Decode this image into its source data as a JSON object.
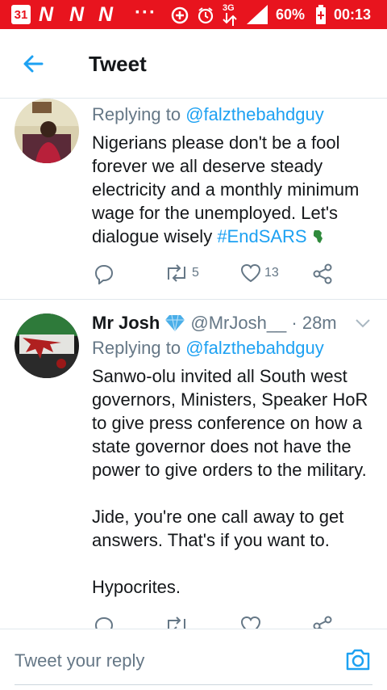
{
  "status_bar": {
    "calendar_day": "31",
    "notif_letters": [
      "N",
      "N",
      "N"
    ],
    "more_dots": "···",
    "network_type": "3G",
    "battery": "60%",
    "time": "00:13",
    "bar_color": "#e8141e"
  },
  "appbar": {
    "title": "Tweet",
    "back_icon": "arrow-left-icon"
  },
  "tweets": [
    {
      "header_partial": "",
      "replying_prefix": "Replying to ",
      "replying_to": "@falzthebahdguy",
      "text_main": "Nigerians please don't be a fool forever we all deserve steady electricity and a monthly minimum wage for the unemployed. Let's dialogue wisely ",
      "hashtag": "#EndSARS",
      "retweets": "5",
      "likes": "13"
    },
    {
      "name": "Mr Josh",
      "handle": "@MrJosh__ · 28m",
      "replying_prefix": "Replying to ",
      "replying_to": "@falzthebahdguy",
      "text": "Sanwo-olu invited all South west governors, Ministers, Speaker HoR to give press conference on how a state governor does not have the power to give orders to the military.\n\nJide, you're one call away to get answers. That's if you want to.\n\nHypocrites."
    }
  ],
  "composer": {
    "placeholder": "Tweet your reply",
    "camera_icon": "camera-icon"
  },
  "colors": {
    "accent": "#1da1f2",
    "secondary_text": "#657786",
    "primary_text": "#14171a"
  }
}
